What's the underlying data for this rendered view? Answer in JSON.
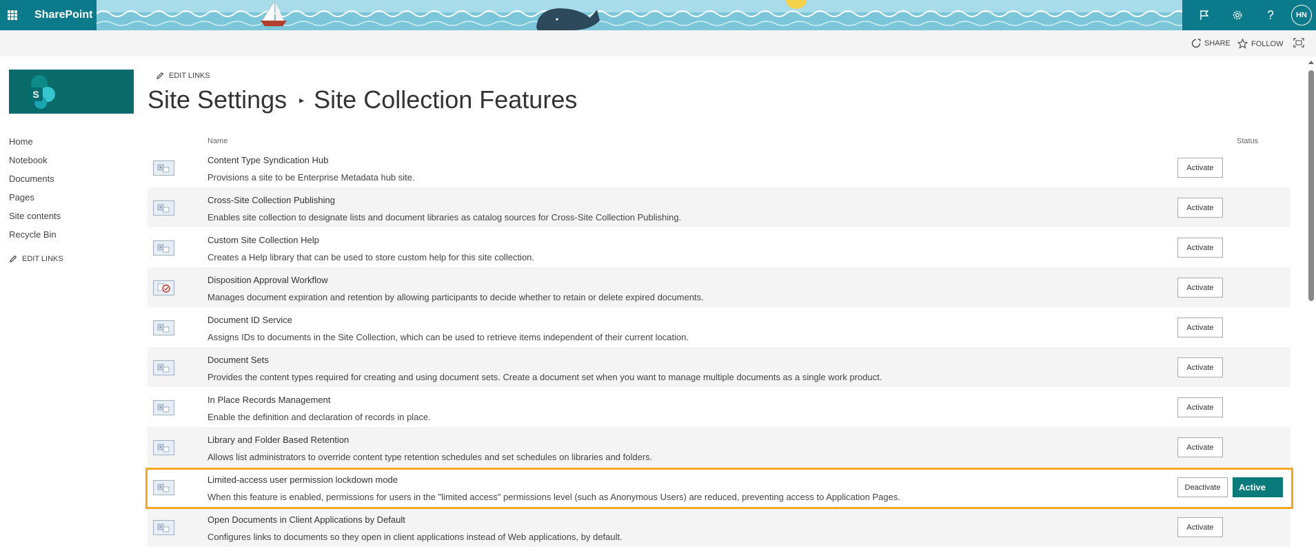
{
  "suite": {
    "brand": "SharePoint",
    "avatar_initials": "HN",
    "icons": [
      "waffle-icon",
      "flag-icon",
      "gear-icon",
      "help-icon"
    ],
    "help_glyph": "?"
  },
  "actions": {
    "share": "SHARE",
    "follow": "FOLLOW"
  },
  "nav": {
    "items": [
      "Home",
      "Notebook",
      "Documents",
      "Pages",
      "Site contents",
      "Recycle Bin"
    ],
    "edit_links": "EDIT LINKS"
  },
  "main": {
    "edit_links": "EDIT LINKS",
    "breadcrumb_parent": "Site Settings",
    "breadcrumb_separator": "▸",
    "title": "Site Collection Features",
    "column_name": "Name",
    "column_status": "Status"
  },
  "features": [
    {
      "title": "Content Type Syndication Hub",
      "description": "Provisions a site to be Enterprise Metadata hub site.",
      "button": "Activate",
      "status": ""
    },
    {
      "title": "Cross-Site Collection Publishing",
      "description": "Enables site collection to designate lists and document libraries as catalog sources for Cross-Site Collection Publishing.",
      "button": "Activate",
      "status": ""
    },
    {
      "title": "Custom Site Collection Help",
      "description": "Creates a Help library that can be used to store custom help for this site collection.",
      "button": "Activate",
      "status": ""
    },
    {
      "title": "Disposition Approval Workflow",
      "description": "Manages document expiration and retention by allowing participants to decide whether to retain or delete expired documents.",
      "button": "Activate",
      "status": ""
    },
    {
      "title": "Document ID Service",
      "description": "Assigns IDs to documents in the Site Collection, which can be used to retrieve items independent of their current location.",
      "button": "Activate",
      "status": ""
    },
    {
      "title": "Document Sets",
      "description": "Provides the content types required for creating and using document sets. Create a document set when you want to manage multiple documents as a single work product.",
      "button": "Activate",
      "status": ""
    },
    {
      "title": "In Place Records Management",
      "description": "Enable the definition and declaration of records in place.",
      "button": "Activate",
      "status": ""
    },
    {
      "title": "Library and Folder Based Retention",
      "description": "Allows list administrators to override content type retention schedules and set schedules on libraries and folders.",
      "button": "Activate",
      "status": ""
    },
    {
      "title": "Limited-access user permission lockdown mode",
      "description": "When this feature is enabled, permissions for users in the \"limited access\" permissions level (such as Anonymous Users) are reduced, preventing access to Application Pages.",
      "button": "Deactivate",
      "status": "Active"
    },
    {
      "title": "Open Documents in Client Applications by Default",
      "description": "Configures links to documents so they open in client applications instead of Web applications, by default.",
      "button": "Activate",
      "status": ""
    }
  ],
  "colors": {
    "suite_teal": "#0b7a8a",
    "sea": "#7cc6d9",
    "active_status": "#0b7a7a",
    "highlight": "#f5a623",
    "logo_bg": "#0b6b6b"
  }
}
